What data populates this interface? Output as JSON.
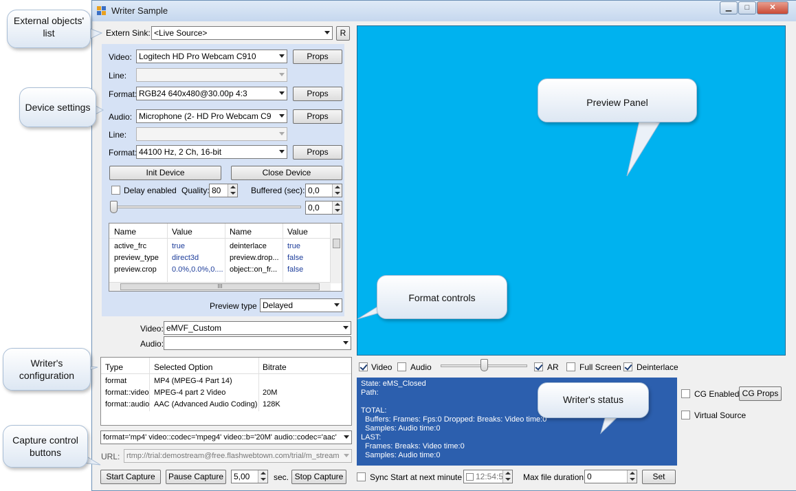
{
  "window": {
    "title": "Writer Sample",
    "minimize": "▁",
    "maximize": "□",
    "close": "✕"
  },
  "extern_sink": {
    "label": "Extern Sink:",
    "value": "<Live Source>",
    "refresh_label": "R"
  },
  "device": {
    "video_label": "Video:",
    "video_value": "Logitech HD Pro Webcam C910",
    "line_label": "Line:",
    "format_label": "Format:",
    "video_format_value": "RGB24 640x480@30.00p 4:3",
    "audio_label": "Audio:",
    "audio_value": "Microphone (2- HD Pro Webcam C9",
    "audio_format_value": "44100 Hz, 2 Ch, 16-bit",
    "props_label": "Props",
    "init_label": "Init Device",
    "close_label": "Close Device",
    "delay_label": "Delay enabled",
    "quality_label": "Quality:",
    "quality_value": "80",
    "buffered_label": "Buffered (sec):",
    "buffered_value": "0,0",
    "slider_value": "0,0",
    "preview_type_label": "Preview type",
    "preview_type_value": "Delayed"
  },
  "props_grid": {
    "headers": [
      "Name",
      "Value",
      "Name",
      "Value"
    ],
    "rows": [
      [
        "active_frc",
        "true",
        "deinterlace",
        "true"
      ],
      [
        "preview_type",
        "direct3d",
        "preview.drop...",
        "false"
      ],
      [
        "preview.crop",
        "0.0%,0.0%,0....",
        "object::on_fr...",
        "false"
      ]
    ],
    "scroll_thumb": "III"
  },
  "format_controls": {
    "video_label": "Video:",
    "video_value": "eMVF_Custom",
    "audio_label": "Audio:",
    "audio_value": ""
  },
  "writer_grid": {
    "headers": [
      "Type",
      "Selected Option",
      "Bitrate"
    ],
    "rows": [
      [
        "format",
        "MP4 (MPEG-4 Part 14)",
        ""
      ],
      [
        "format::video",
        "MPEG-4 part 2 Video",
        "20M"
      ],
      [
        "format::audio",
        "AAC (Advanced Audio Coding)",
        "128K"
      ]
    ]
  },
  "config_string": "format='mp4' video::codec='mpeg4' video::b='20M' audio::codec='aac'",
  "url": {
    "label": "URL:",
    "value": "rtmp://trial:demostream@free.flashwebtown.com/trial/m_stream"
  },
  "capture": {
    "start_label": "Start Capture",
    "pause_label": "Pause Capture",
    "pause_value": "5,00",
    "sec_label": "sec.",
    "stop_label": "Stop Capture",
    "sync_label": "Sync Start at next minute",
    "time_value": "12:54:5",
    "max_duration_label": "Max file duration:",
    "max_duration_value": "0",
    "set_label": "Set"
  },
  "preview_opts": {
    "video_label": "Video",
    "audio_label": "Audio",
    "ar_label": "AR",
    "fullscreen_label": "Full Screen",
    "deinterlace_label": "Deinterlace"
  },
  "status": {
    "lines": [
      "State: eMS_Closed",
      "Path:",
      "",
      "TOTAL:",
      "Buffers: Frames: Fps:0 Dropped: Breaks: Video time:0",
      "Samples: Audio time:0",
      "LAST:",
      "Frames: Breaks: Video time:0",
      "Samples: Audio time:0"
    ]
  },
  "cg": {
    "enabled_label": "CG Enabled",
    "props_label": "CG Props",
    "virtual_label": "Virtual Source"
  },
  "callouts": {
    "external": "External objects' list",
    "device": "Device settings",
    "preview": "Preview Panel",
    "format": "Format controls",
    "writer_config": "Writer's configuration",
    "writer_status": "Writer's status",
    "capture_buttons": "Capture control buttons"
  },
  "colors": {
    "preview_bg": "#00b2ef",
    "status_bg": "#2c5fae",
    "device_panel_bg": "#d6e2f5"
  }
}
